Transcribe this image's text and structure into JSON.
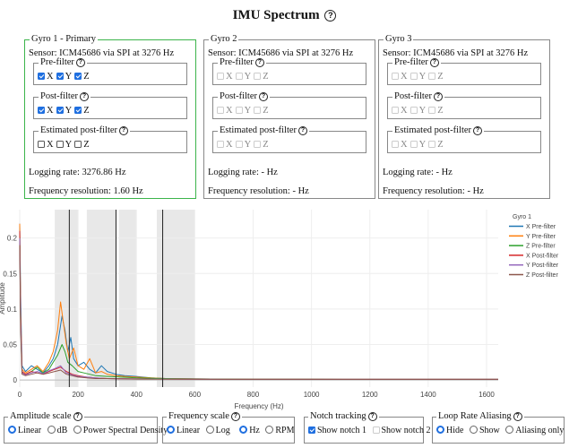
{
  "page": {
    "title": "IMU Spectrum"
  },
  "gyros": [
    {
      "title": "Gyro 1 - Primary",
      "sensor": "Sensor: ICM45686 via SPI at 3276 Hz",
      "pre_filter": {
        "label": "Pre-filter",
        "x": true,
        "y": true,
        "z": true,
        "enabled": true
      },
      "post_filter": {
        "label": "Post-filter",
        "x": true,
        "y": true,
        "z": true,
        "enabled": true
      },
      "est_post_filter": {
        "label": "Estimated post-filter",
        "x": false,
        "y": false,
        "z": false,
        "enabled": true
      },
      "logging_rate": "Logging rate: 3276.86 Hz",
      "freq_resolution": "Frequency resolution: 1.60 Hz"
    },
    {
      "title": "Gyro 2",
      "sensor": "Sensor: ICM45686 via SPI at 3276 Hz",
      "pre_filter": {
        "label": "Pre-filter",
        "x": false,
        "y": false,
        "z": false,
        "enabled": false
      },
      "post_filter": {
        "label": "Post-filter",
        "x": false,
        "y": false,
        "z": false,
        "enabled": false
      },
      "est_post_filter": {
        "label": "Estimated post-filter",
        "x": false,
        "y": false,
        "z": false,
        "enabled": false
      },
      "logging_rate": "Logging rate: - Hz",
      "freq_resolution": "Frequency resolution: - Hz"
    },
    {
      "title": "Gyro 3",
      "sensor": "Sensor: ICM45686 via SPI at 3276 Hz",
      "pre_filter": {
        "label": "Pre-filter",
        "x": false,
        "y": false,
        "z": false,
        "enabled": false
      },
      "post_filter": {
        "label": "Post-filter",
        "x": false,
        "y": false,
        "z": false,
        "enabled": false
      },
      "est_post_filter": {
        "label": "Estimated post-filter",
        "x": false,
        "y": false,
        "z": false,
        "enabled": false
      },
      "logging_rate": "Logging rate: - Hz",
      "freq_resolution": "Frequency resolution: - Hz"
    }
  ],
  "axis_labels": {
    "x": "X",
    "y": "Y",
    "z": "Z"
  },
  "chart_data": {
    "type": "line",
    "xlabel": "Frequency (Hz)",
    "ylabel": "Amplitude",
    "xlim": [
      0,
      1640
    ],
    "ylim": [
      -0.01,
      0.24
    ],
    "xticks": [
      0,
      200,
      400,
      600,
      800,
      1000,
      1200,
      1400,
      1600
    ],
    "yticks": [
      0,
      0.05,
      0.1,
      0.15,
      0.2
    ],
    "ytick_labels": [
      "0",
      "0.05",
      "0.1",
      "0.15",
      "0.2"
    ],
    "legend_title": "Gyro 1",
    "legend_position": "right",
    "shaded_bands": [
      [
        120,
        200
      ],
      [
        230,
        330
      ],
      [
        340,
        400
      ],
      [
        470,
        600
      ]
    ],
    "vertical_lines": [
      170,
      330,
      490
    ],
    "series": [
      {
        "name": "X Pre-filter",
        "color": "#1f77b4",
        "points": [
          [
            0,
            0.22
          ],
          [
            3,
            0.12
          ],
          [
            8,
            0.02
          ],
          [
            20,
            0.012
          ],
          [
            40,
            0.02
          ],
          [
            60,
            0.015
          ],
          [
            80,
            0.01
          ],
          [
            100,
            0.02
          ],
          [
            115,
            0.03
          ],
          [
            130,
            0.05
          ],
          [
            145,
            0.09
          ],
          [
            155,
            0.07
          ],
          [
            165,
            0.04
          ],
          [
            175,
            0.06
          ],
          [
            185,
            0.03
          ],
          [
            200,
            0.02
          ],
          [
            220,
            0.025
          ],
          [
            240,
            0.015
          ],
          [
            260,
            0.01
          ],
          [
            280,
            0.02
          ],
          [
            300,
            0.012
          ],
          [
            330,
            0.008
          ],
          [
            360,
            0.006
          ],
          [
            400,
            0.005
          ],
          [
            450,
            0.003
          ],
          [
            500,
            0.002
          ],
          [
            600,
            0.0015
          ],
          [
            800,
            0.001
          ],
          [
            1000,
            0.001
          ],
          [
            1200,
            0.0008
          ],
          [
            1400,
            0.0008
          ],
          [
            1640,
            0.0008
          ]
        ]
      },
      {
        "name": "Y Pre-filter",
        "color": "#ff7f0e",
        "points": [
          [
            0,
            0.22
          ],
          [
            3,
            0.1
          ],
          [
            8,
            0.015
          ],
          [
            20,
            0.01
          ],
          [
            40,
            0.015
          ],
          [
            60,
            0.02
          ],
          [
            80,
            0.012
          ],
          [
            100,
            0.025
          ],
          [
            115,
            0.04
          ],
          [
            130,
            0.07
          ],
          [
            140,
            0.11
          ],
          [
            150,
            0.08
          ],
          [
            160,
            0.05
          ],
          [
            170,
            0.03
          ],
          [
            185,
            0.045
          ],
          [
            200,
            0.02
          ],
          [
            220,
            0.015
          ],
          [
            240,
            0.03
          ],
          [
            260,
            0.01
          ],
          [
            280,
            0.012
          ],
          [
            300,
            0.008
          ],
          [
            330,
            0.006
          ],
          [
            360,
            0.005
          ],
          [
            400,
            0.004
          ],
          [
            450,
            0.003
          ],
          [
            500,
            0.002
          ],
          [
            600,
            0.0015
          ],
          [
            800,
            0.001
          ],
          [
            1000,
            0.001
          ],
          [
            1200,
            0.0008
          ],
          [
            1400,
            0.0008
          ],
          [
            1640,
            0.0008
          ]
        ]
      },
      {
        "name": "Z Pre-filter",
        "color": "#2ca02c",
        "points": [
          [
            0,
            0.2
          ],
          [
            3,
            0.08
          ],
          [
            8,
            0.01
          ],
          [
            20,
            0.008
          ],
          [
            40,
            0.012
          ],
          [
            60,
            0.018
          ],
          [
            80,
            0.01
          ],
          [
            100,
            0.015
          ],
          [
            115,
            0.025
          ],
          [
            130,
            0.035
          ],
          [
            145,
            0.05
          ],
          [
            155,
            0.04
          ],
          [
            165,
            0.025
          ],
          [
            180,
            0.02
          ],
          [
            200,
            0.012
          ],
          [
            220,
            0.01
          ],
          [
            240,
            0.008
          ],
          [
            260,
            0.006
          ],
          [
            300,
            0.005
          ],
          [
            350,
            0.004
          ],
          [
            400,
            0.003
          ],
          [
            500,
            0.002
          ],
          [
            600,
            0.0015
          ],
          [
            800,
            0.001
          ],
          [
            1000,
            0.001
          ],
          [
            1200,
            0.0008
          ],
          [
            1400,
            0.0008
          ],
          [
            1640,
            0.0008
          ]
        ]
      },
      {
        "name": "X Post-filter",
        "color": "#d62728",
        "points": [
          [
            0,
            0.21
          ],
          [
            3,
            0.09
          ],
          [
            8,
            0.012
          ],
          [
            20,
            0.008
          ],
          [
            40,
            0.012
          ],
          [
            60,
            0.01
          ],
          [
            80,
            0.008
          ],
          [
            100,
            0.012
          ],
          [
            120,
            0.015
          ],
          [
            140,
            0.018
          ],
          [
            160,
            0.012
          ],
          [
            180,
            0.008
          ],
          [
            200,
            0.006
          ],
          [
            230,
            0.004
          ],
          [
            260,
            0.003
          ],
          [
            300,
            0.002
          ],
          [
            400,
            0.0015
          ],
          [
            600,
            0.001
          ],
          [
            1000,
            0.0008
          ],
          [
            1640,
            0.0008
          ]
        ]
      },
      {
        "name": "Y Post-filter",
        "color": "#9467bd",
        "points": [
          [
            0,
            0.2
          ],
          [
            3,
            0.085
          ],
          [
            8,
            0.01
          ],
          [
            20,
            0.007
          ],
          [
            40,
            0.01
          ],
          [
            60,
            0.012
          ],
          [
            80,
            0.009
          ],
          [
            100,
            0.013
          ],
          [
            120,
            0.016
          ],
          [
            140,
            0.02
          ],
          [
            160,
            0.01
          ],
          [
            180,
            0.007
          ],
          [
            200,
            0.005
          ],
          [
            230,
            0.004
          ],
          [
            260,
            0.003
          ],
          [
            300,
            0.002
          ],
          [
            400,
            0.0015
          ],
          [
            600,
            0.001
          ],
          [
            1000,
            0.0008
          ],
          [
            1640,
            0.0008
          ]
        ]
      },
      {
        "name": "Z Post-filter",
        "color": "#8c564b",
        "points": [
          [
            0,
            0.19
          ],
          [
            3,
            0.07
          ],
          [
            8,
            0.008
          ],
          [
            20,
            0.006
          ],
          [
            40,
            0.008
          ],
          [
            60,
            0.01
          ],
          [
            80,
            0.008
          ],
          [
            100,
            0.01
          ],
          [
            120,
            0.012
          ],
          [
            140,
            0.014
          ],
          [
            160,
            0.008
          ],
          [
            180,
            0.006
          ],
          [
            200,
            0.004
          ],
          [
            230,
            0.003
          ],
          [
            260,
            0.002
          ],
          [
            300,
            0.002
          ],
          [
            400,
            0.0012
          ],
          [
            600,
            0.001
          ],
          [
            1000,
            0.0008
          ],
          [
            1640,
            0.0008
          ]
        ]
      }
    ]
  },
  "controls": {
    "amplitude_scale": {
      "label": "Amplitude scale",
      "options": [
        "Linear",
        "dB",
        "Power Spectral Density"
      ],
      "selected": "Linear"
    },
    "frequency_scale": {
      "label": "Frequency scale",
      "options": [
        "Linear",
        "Log",
        "Hz",
        "RPM"
      ],
      "selected": [
        "Linear",
        "Hz"
      ]
    },
    "notch_tracking": {
      "label": "Notch tracking",
      "options": [
        "Show notch 1",
        "Show notch 2"
      ],
      "checked": [
        "Show notch 1"
      ]
    },
    "loop_rate_aliasing": {
      "label": "Loop Rate Aliasing",
      "options": [
        "Hide",
        "Show",
        "Aliasing only"
      ],
      "selected": "Hide"
    }
  },
  "colors": {
    "accent": "#1f6fe0",
    "primary_border": "#3cb44b",
    "band": "#e8e8e8"
  },
  "icons": {
    "help": "help-circle-icon"
  }
}
